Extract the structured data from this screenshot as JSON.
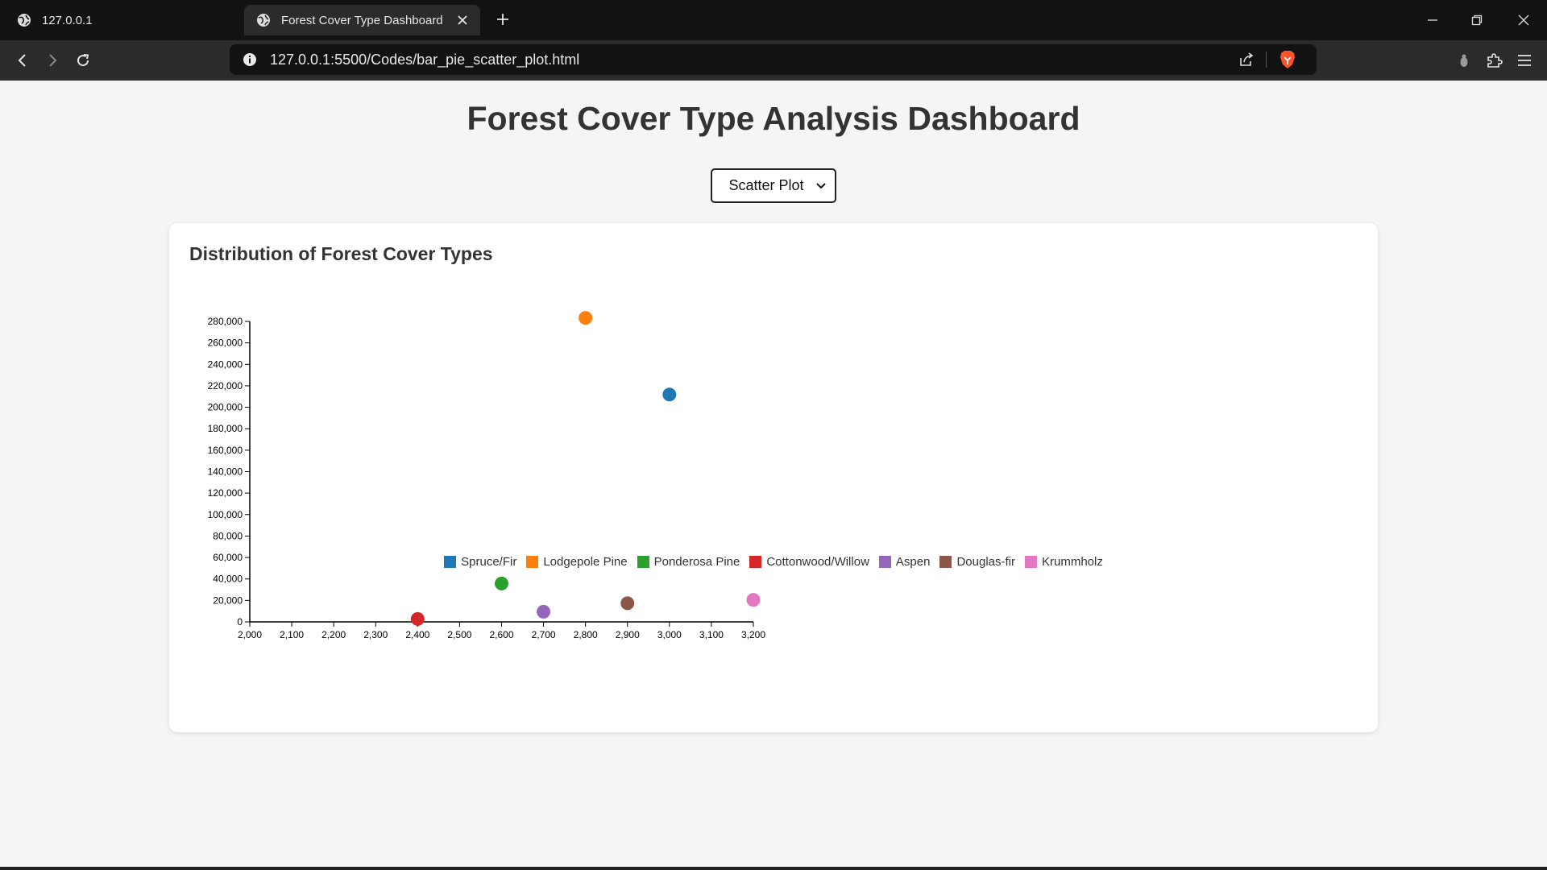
{
  "browser": {
    "tabs": [
      {
        "title": "127.0.0.1",
        "active": false
      },
      {
        "title": "Forest Cover Type Dashboard",
        "active": true
      }
    ],
    "url": "127.0.0.1:5500/Codes/bar_pie_scatter_plot.html"
  },
  "page": {
    "title": "Forest Cover Type Analysis Dashboard",
    "chart_selector": {
      "selected": "Scatter Plot"
    },
    "card_title": "Distribution of Forest Cover Types"
  },
  "chart_data": {
    "type": "scatter",
    "title": "Distribution of Forest Cover Types",
    "xlabel": "",
    "ylabel": "",
    "xlim": [
      2000,
      3200
    ],
    "ylim": [
      0,
      280000
    ],
    "x_ticks": [
      2000,
      2100,
      2200,
      2300,
      2400,
      2500,
      2600,
      2700,
      2800,
      2900,
      3000,
      3100,
      3200
    ],
    "y_ticks": [
      0,
      20000,
      40000,
      60000,
      80000,
      100000,
      120000,
      140000,
      160000,
      180000,
      200000,
      220000,
      240000,
      260000,
      280000
    ],
    "x_tick_labels": [
      "2,000",
      "2,100",
      "2,200",
      "2,300",
      "2,400",
      "2,500",
      "2,600",
      "2,700",
      "2,800",
      "2,900",
      "3,000",
      "3,100",
      "3,200"
    ],
    "y_tick_labels": [
      "0",
      "20,000",
      "40,000",
      "60,000",
      "80,000",
      "100,000",
      "120,000",
      "140,000",
      "160,000",
      "180,000",
      "200,000",
      "220,000",
      "240,000",
      "260,000",
      "280,000"
    ],
    "grid": false,
    "legend_position": "bottom-center",
    "series": [
      {
        "name": "Spruce/Fir",
        "color": "#1f77b4",
        "x": 3000,
        "y": 211840
      },
      {
        "name": "Lodgepole Pine",
        "color": "#ff7f0e",
        "x": 2800,
        "y": 283301
      },
      {
        "name": "Ponderosa Pine",
        "color": "#2ca02c",
        "x": 2600,
        "y": 35754
      },
      {
        "name": "Cottonwood/Willow",
        "color": "#d62728",
        "x": 2400,
        "y": 2747
      },
      {
        "name": "Aspen",
        "color": "#9467bd",
        "x": 2700,
        "y": 9493
      },
      {
        "name": "Douglas-fir",
        "color": "#8c564b",
        "x": 2900,
        "y": 17367
      },
      {
        "name": "Krummholz",
        "color": "#e377c2",
        "x": 3200,
        "y": 20510
      }
    ]
  }
}
